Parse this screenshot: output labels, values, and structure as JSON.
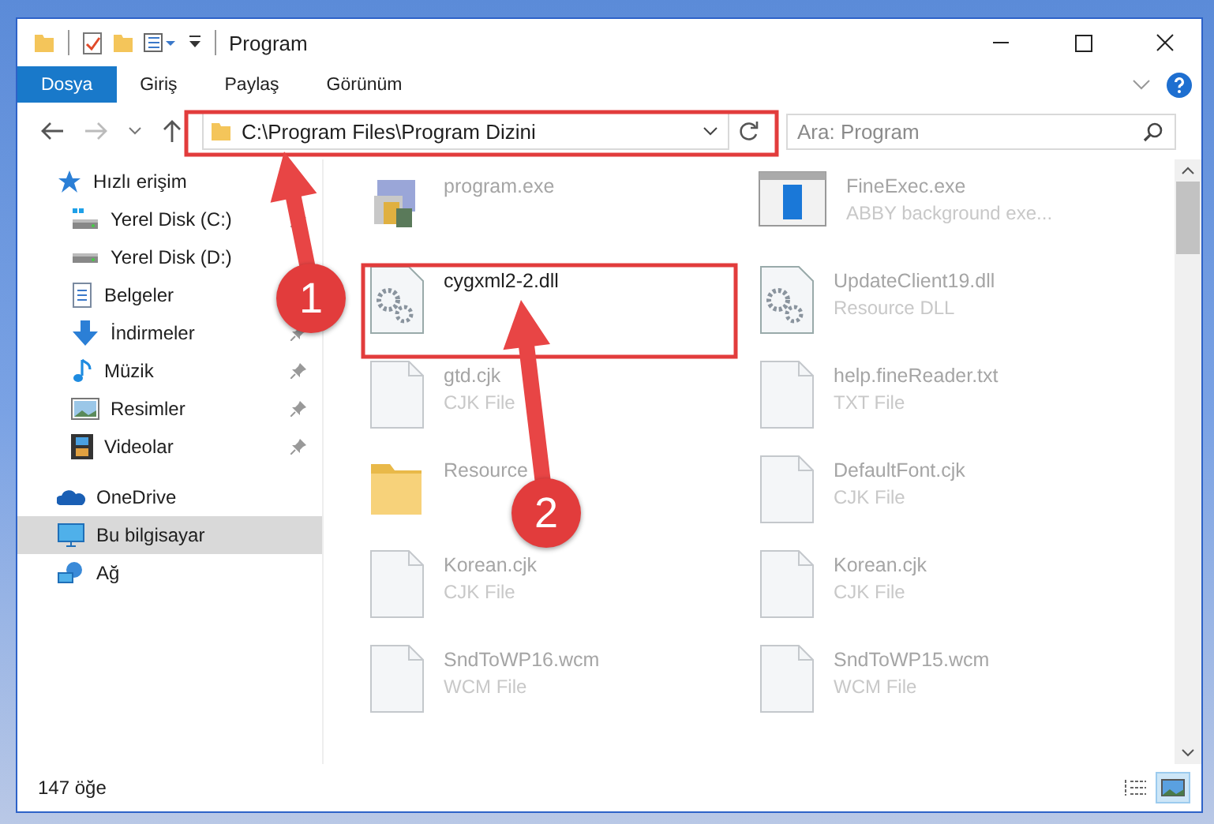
{
  "window": {
    "title": "Program"
  },
  "ribbon_tabs": [
    {
      "label": "Dosya",
      "selected": true
    },
    {
      "label": "Giriş",
      "selected": false
    },
    {
      "label": "Paylaş",
      "selected": false
    },
    {
      "label": "Görünüm",
      "selected": false
    }
  ],
  "address": {
    "path": "C:\\Program Files\\Program Dizini"
  },
  "search": {
    "placeholder": "Ara: Program"
  },
  "sidebar": {
    "items": [
      {
        "label": "Hızlı erişim",
        "selected": false,
        "children": [
          {
            "label": "Yerel Disk (C:)",
            "pinned": true
          },
          {
            "label": "Yerel Disk (D:)",
            "pinned": false
          },
          {
            "label": "Belgeler",
            "pinned": false
          },
          {
            "label": "İndirmeler",
            "pinned": true
          },
          {
            "label": "Müzik",
            "pinned": true
          },
          {
            "label": "Resimler",
            "pinned": true
          },
          {
            "label": "Videolar",
            "pinned": true
          }
        ]
      },
      {
        "label": "OneDrive",
        "selected": false
      },
      {
        "label": "Bu bilgisayar",
        "selected": true
      },
      {
        "label": "Ağ",
        "selected": false
      }
    ]
  },
  "files": [
    {
      "name": "program.exe",
      "kind": "exe",
      "blurred": true
    },
    {
      "name": "FineExec.exe",
      "type": "ABBY background exe...",
      "kind": "app",
      "blurred": true
    },
    {
      "name": "cygxml2-2.dll",
      "kind": "dll",
      "blurred": false
    },
    {
      "name": "UpdateClient19.dll",
      "type": "Resource DLL",
      "kind": "dll",
      "blurred": true
    },
    {
      "name": "gtd.cjk",
      "type": "CJK File",
      "kind": "file",
      "blurred": true
    },
    {
      "name": "help.fineReader.txt",
      "type": "TXT File",
      "kind": "file",
      "blurred": true
    },
    {
      "name": "Resource",
      "kind": "folder",
      "blurred": true
    },
    {
      "name": "DefaultFont.cjk",
      "type": "CJK File",
      "kind": "file",
      "blurred": true
    },
    {
      "name": "Korean.cjk",
      "type": "CJK File",
      "kind": "file",
      "blurred": true
    },
    {
      "name": "Korean.cjk",
      "type": "CJK File",
      "kind": "file",
      "blurred": true
    },
    {
      "name": "SndToWP16.wcm",
      "type": "WCM File",
      "kind": "file",
      "blurred": true
    },
    {
      "name": "SndToWP15.wcm",
      "type": "WCM File",
      "kind": "file",
      "blurred": true
    }
  ],
  "status_bar": {
    "item_count": "147 öğe"
  },
  "views": [
    {
      "kind": "details",
      "selected": false
    },
    {
      "kind": "large-icons",
      "selected": true
    }
  ],
  "callouts": [
    {
      "number": "1"
    },
    {
      "number": "2"
    }
  ]
}
